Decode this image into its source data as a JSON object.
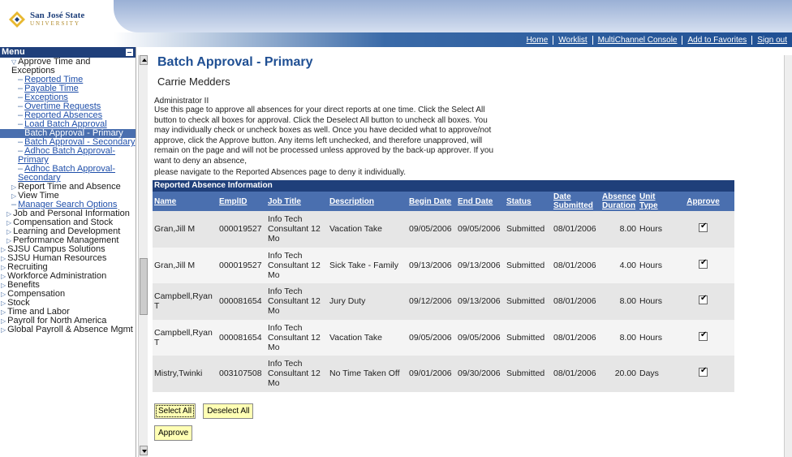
{
  "branding": {
    "logo_line1": "San José State",
    "logo_line2": "UNIVERSITY"
  },
  "header": {
    "links": [
      "Home",
      "Worklist",
      "MultiChannel Console",
      "Add to Favorites",
      "Sign out"
    ]
  },
  "menu": {
    "title": "Menu",
    "items": [
      {
        "text": "Approve Time and Exceptions",
        "kind": "folder-open",
        "indent": 1
      },
      {
        "text": "Reported Time",
        "kind": "link",
        "indent": 2
      },
      {
        "text": "Payable Time",
        "kind": "link",
        "indent": 2
      },
      {
        "text": "Exceptions",
        "kind": "link",
        "indent": 2
      },
      {
        "text": "Overtime Requests",
        "kind": "link",
        "indent": 2
      },
      {
        "text": "Reported Absences",
        "kind": "link",
        "indent": 2
      },
      {
        "text": "Load Batch Approval",
        "kind": "link",
        "indent": 2
      },
      {
        "text": "Batch Approval - Primary",
        "kind": "selected",
        "indent": 2
      },
      {
        "text": "Batch Approval - Secondary",
        "kind": "link",
        "indent": 2
      },
      {
        "text": "Adhoc Batch Approval-Primary",
        "kind": "link",
        "indent": 2
      },
      {
        "text": "Adhoc Batch Approval-Secondary",
        "kind": "link",
        "indent": 2
      },
      {
        "text": "Report Time and Absence",
        "kind": "folder",
        "indent": 1
      },
      {
        "text": "View Time",
        "kind": "folder",
        "indent": 1
      },
      {
        "text": "Manager Search Options",
        "kind": "link",
        "indent": 1
      },
      {
        "text": "Job and Personal Information",
        "kind": "folder",
        "indent": 0
      },
      {
        "text": "Compensation and Stock",
        "kind": "folder",
        "indent": 0
      },
      {
        "text": "Learning and Development",
        "kind": "folder",
        "indent": 0
      },
      {
        "text": "Performance Management",
        "kind": "folder",
        "indent": 0
      },
      {
        "text": "SJSU Campus Solutions",
        "kind": "folder",
        "indent": -1
      },
      {
        "text": "SJSU Human Resources",
        "kind": "folder",
        "indent": -1
      },
      {
        "text": "Recruiting",
        "kind": "folder",
        "indent": -1
      },
      {
        "text": "Workforce Administration",
        "kind": "folder",
        "indent": -1
      },
      {
        "text": "Benefits",
        "kind": "folder",
        "indent": -1
      },
      {
        "text": "Compensation",
        "kind": "folder",
        "indent": -1
      },
      {
        "text": "Stock",
        "kind": "folder",
        "indent": -1
      },
      {
        "text": "Time and Labor",
        "kind": "folder",
        "indent": -1
      },
      {
        "text": "Payroll for North America",
        "kind": "folder",
        "indent": -1
      },
      {
        "text": "Global Payroll & Absence Mgmt",
        "kind": "folder",
        "indent": -1
      }
    ]
  },
  "page": {
    "title": "Batch Approval - Primary",
    "employee_name": "Carrie Medders",
    "role": "Administrator II",
    "instructions": "Use this page to approve all absences for your direct reports at one time. Click the Select All button to check all boxes for approval. Click the Deselect All button to uncheck all boxes. You may individually check or uncheck boxes as well. Once you have decided what to approve/not approve, click the Approve button. Any items left unchecked, and therefore unapproved, will remain on the page and will not be processed unless approved by the back-up approver. If you want to deny an absence,",
    "instructions2": "please navigate to the Reported Absences page to deny it individually."
  },
  "table": {
    "caption": "Reported Absence Information",
    "headers": [
      "Name",
      "EmplID",
      "Job Title",
      "Description",
      "Begin Date",
      "End Date",
      "Status",
      "Date Submitted",
      "Absence Duration",
      "Unit Type",
      "Approve"
    ],
    "rows": [
      {
        "name": "Gran,Jill M",
        "emplid": "000019527",
        "job": "Info Tech Consultant 12 Mo",
        "desc": "Vacation Take",
        "begin": "09/05/2006",
        "end": "09/05/2006",
        "status": "Submitted",
        "submitted": "08/01/2006",
        "duration": "8.00",
        "unit": "Hours",
        "approve": true
      },
      {
        "name": "Gran,Jill M",
        "emplid": "000019527",
        "job": "Info Tech Consultant 12 Mo",
        "desc": "Sick Take - Family",
        "begin": "09/13/2006",
        "end": "09/13/2006",
        "status": "Submitted",
        "submitted": "08/01/2006",
        "duration": "4.00",
        "unit": "Hours",
        "approve": true
      },
      {
        "name": "Campbell,Ryan T",
        "emplid": "000081654",
        "job": "Info Tech Consultant 12 Mo",
        "desc": "Jury Duty",
        "begin": "09/12/2006",
        "end": "09/13/2006",
        "status": "Submitted",
        "submitted": "08/01/2006",
        "duration": "8.00",
        "unit": "Hours",
        "approve": true
      },
      {
        "name": "Campbell,Ryan T",
        "emplid": "000081654",
        "job": "Info Tech Consultant 12 Mo",
        "desc": "Vacation Take",
        "begin": "09/05/2006",
        "end": "09/05/2006",
        "status": "Submitted",
        "submitted": "08/01/2006",
        "duration": "8.00",
        "unit": "Hours",
        "approve": true
      },
      {
        "name": "Mistry,Twinki",
        "emplid": "003107508",
        "job": "Info Tech Consultant 12 Mo",
        "desc": "No Time Taken Off",
        "begin": "09/01/2006",
        "end": "09/30/2006",
        "status": "Submitted",
        "submitted": "08/01/2006",
        "duration": "20.00",
        "unit": "Days",
        "approve": true
      }
    ]
  },
  "buttons": {
    "select_all": "Select All",
    "deselect_all": "Deselect All",
    "approve": "Approve"
  }
}
